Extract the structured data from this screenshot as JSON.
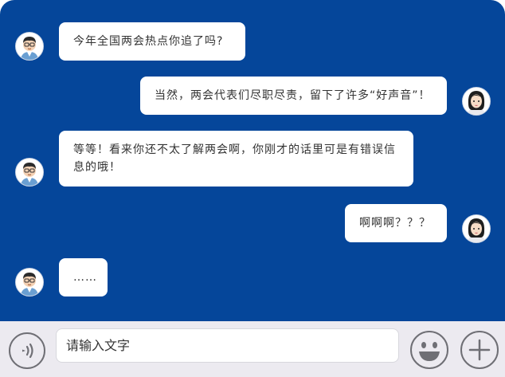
{
  "messages": [
    {
      "sender": "male",
      "text": "今年全国两会热点你追了吗?"
    },
    {
      "sender": "female",
      "text": "当然，两会代表们尽职尽责，留下了许多“好声音”！"
    },
    {
      "sender": "male",
      "text": "等等！看来你还不太了解两会啊，你刚才的话里可是有错误信息的哦！"
    },
    {
      "sender": "female",
      "text": "啊啊啊？？？"
    },
    {
      "sender": "male",
      "text": "……"
    }
  ],
  "input": {
    "placeholder": "请输入文字"
  },
  "icons": {
    "voice": "voice-icon",
    "emoji": "emoji-icon",
    "plus": "plus-icon"
  },
  "colors": {
    "chat_background": "#05469a",
    "bubble": "#ffffff",
    "toolbar": "#eceaf0"
  }
}
